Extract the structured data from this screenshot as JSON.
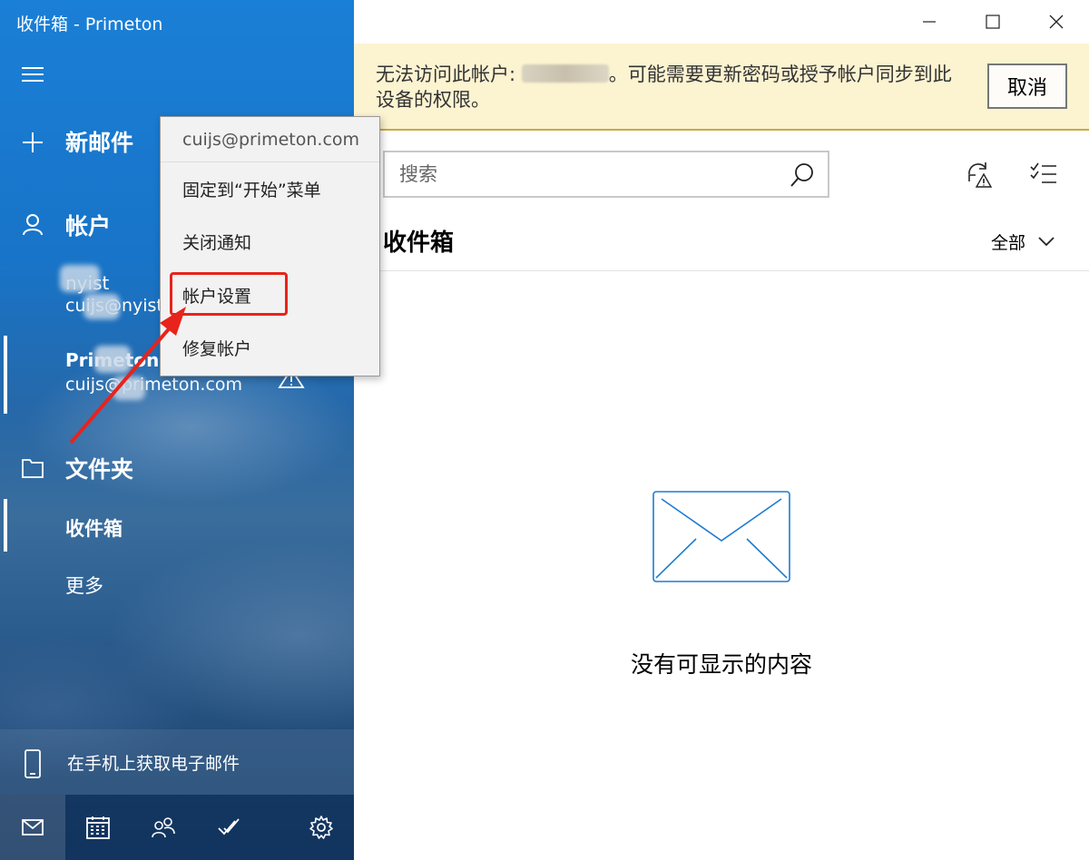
{
  "window": {
    "title": "收件箱 - Primeton"
  },
  "nav": {
    "new_mail": "新邮件",
    "accounts_header": "帐户",
    "accounts": [
      {
        "name": "nyist",
        "email": "cuijs@nyist"
      },
      {
        "name": "Primeton",
        "email": "cuijs@primeton.com",
        "warning": true
      }
    ],
    "folders_header": "文件夹",
    "folders": [
      {
        "label": "收件箱",
        "selected": true
      },
      {
        "label": "更多",
        "selected": false
      }
    ],
    "phone_promo": "在手机上获取电子邮件",
    "bottom_icons": [
      "mail-icon",
      "calendar-icon",
      "people-icon",
      "todo-icon",
      "settings-icon"
    ]
  },
  "context_menu": {
    "header": "cuijs@primeton.com",
    "items": [
      "固定到“开始”菜单",
      "关闭通知",
      "帐户设置",
      "修复帐户"
    ],
    "highlighted": "帐户设置"
  },
  "banner": {
    "text_before": "无法访问此帐户: ",
    "text_after": "。可能需要更新密码或授予帐户同步到此设备的权限。",
    "cancel_label": "取消"
  },
  "search": {
    "placeholder": "搜索"
  },
  "mail_list": {
    "title": "收件箱",
    "filter_label": "全部",
    "empty_message": "没有可显示的内容"
  },
  "colors": {
    "accent": "#1a7fd6",
    "banner_bg": "#fcf3d1",
    "highlight_red": "#e8231c",
    "empty_icon_blue": "#1e7bd0"
  }
}
